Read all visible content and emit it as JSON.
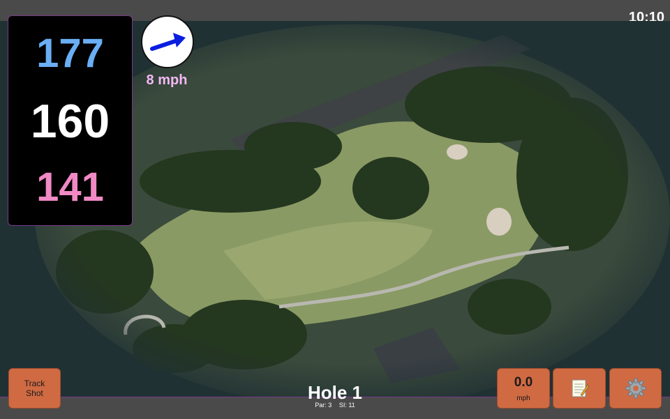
{
  "status": {
    "time": "10:10"
  },
  "distances": {
    "back": "177",
    "middle": "160",
    "front": "141",
    "colors": {
      "back": "#6aaef5",
      "middle": "#ffffff",
      "front": "#f089c4"
    }
  },
  "wind": {
    "speed": "8 mph",
    "arrow_icon": "wind-arrow-icon",
    "arrow_color": "#0a1ee0"
  },
  "hole": {
    "title": "Hole 1",
    "par": "Par: 3",
    "si": "SI: 11"
  },
  "buttons": {
    "track_shot": "Track\nShot",
    "speed_value": "0.0",
    "speed_unit": "mph",
    "notes_icon": "notepad-icon",
    "settings_icon": "gear-icon",
    "accent": "#cf6a43"
  }
}
